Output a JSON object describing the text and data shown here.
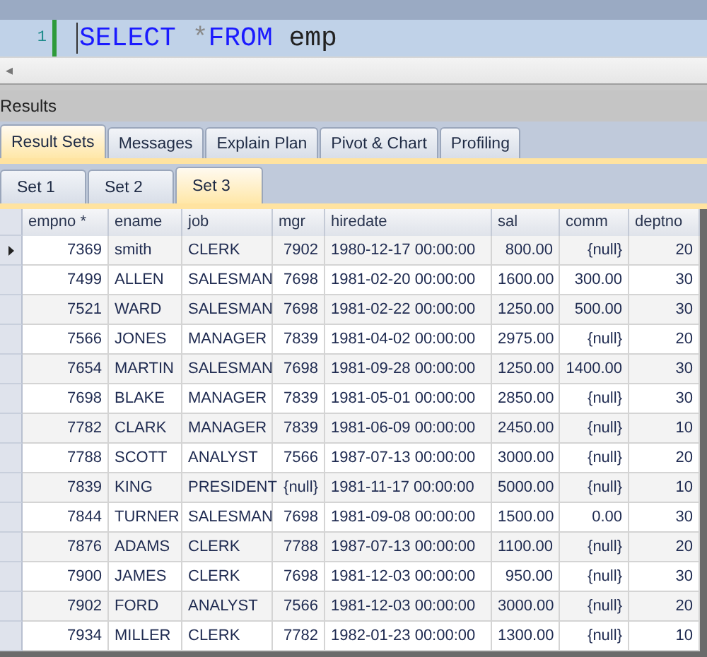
{
  "editor": {
    "line_number": "1",
    "tokens": [
      {
        "kind": "keyword",
        "text": "SELECT"
      },
      {
        "kind": "operator",
        "text": "*"
      },
      {
        "kind": "keyword",
        "text": "FROM"
      },
      {
        "kind": "identifier",
        "text": "emp"
      }
    ]
  },
  "scrollbar": {
    "left_arrow": "◂"
  },
  "results": {
    "title": "Results",
    "tabs": [
      {
        "label": "Result Sets",
        "selected": true
      },
      {
        "label": "Messages",
        "selected": false
      },
      {
        "label": "Explain Plan",
        "selected": false
      },
      {
        "label": "Pivot & Chart",
        "selected": false
      },
      {
        "label": "Profiling",
        "selected": false
      }
    ],
    "sets": [
      {
        "label": "Set 1",
        "selected": false
      },
      {
        "label": "Set 2",
        "selected": false
      },
      {
        "label": "Set 3",
        "selected": true
      }
    ],
    "table": {
      "columns": [
        {
          "label": "empno *",
          "kind": "number"
        },
        {
          "label": "ename",
          "kind": "text"
        },
        {
          "label": "job",
          "kind": "text"
        },
        {
          "label": "mgr",
          "kind": "number"
        },
        {
          "label": "hiredate",
          "kind": "text"
        },
        {
          "label": "sal",
          "kind": "number"
        },
        {
          "label": "comm",
          "kind": "number"
        },
        {
          "label": "deptno",
          "kind": "number"
        }
      ],
      "rows": [
        {
          "selected": true,
          "cells": [
            "7369",
            "smith",
            "CLERK",
            "7902",
            "1980-12-17 00:00:00",
            "800.00",
            "{null}",
            "20"
          ]
        },
        {
          "selected": false,
          "cells": [
            "7499",
            "ALLEN",
            "SALESMAN",
            "7698",
            "1981-02-20 00:00:00",
            "1600.00",
            "300.00",
            "30"
          ]
        },
        {
          "selected": false,
          "cells": [
            "7521",
            "WARD",
            "SALESMAN",
            "7698",
            "1981-02-22 00:00:00",
            "1250.00",
            "500.00",
            "30"
          ]
        },
        {
          "selected": false,
          "cells": [
            "7566",
            "JONES",
            "MANAGER",
            "7839",
            "1981-04-02 00:00:00",
            "2975.00",
            "{null}",
            "20"
          ]
        },
        {
          "selected": false,
          "cells": [
            "7654",
            "MARTIN",
            "SALESMAN",
            "7698",
            "1981-09-28 00:00:00",
            "1250.00",
            "1400.00",
            "30"
          ]
        },
        {
          "selected": false,
          "cells": [
            "7698",
            "BLAKE",
            "MANAGER",
            "7839",
            "1981-05-01 00:00:00",
            "2850.00",
            "{null}",
            "30"
          ]
        },
        {
          "selected": false,
          "cells": [
            "7782",
            "CLARK",
            "MANAGER",
            "7839",
            "1981-06-09 00:00:00",
            "2450.00",
            "{null}",
            "10"
          ]
        },
        {
          "selected": false,
          "cells": [
            "7788",
            "SCOTT",
            "ANALYST",
            "7566",
            "1987-07-13 00:00:00",
            "3000.00",
            "{null}",
            "20"
          ]
        },
        {
          "selected": false,
          "cells": [
            "7839",
            "KING",
            "PRESIDENT",
            "{null}",
            "1981-11-17 00:00:00",
            "5000.00",
            "{null}",
            "10"
          ]
        },
        {
          "selected": false,
          "cells": [
            "7844",
            "TURNER",
            "SALESMAN",
            "7698",
            "1981-09-08 00:00:00",
            "1500.00",
            "0.00",
            "30"
          ]
        },
        {
          "selected": false,
          "cells": [
            "7876",
            "ADAMS",
            "CLERK",
            "7788",
            "1987-07-13 00:00:00",
            "1100.00",
            "{null}",
            "20"
          ]
        },
        {
          "selected": false,
          "cells": [
            "7900",
            "JAMES",
            "CLERK",
            "7698",
            "1981-12-03 00:00:00",
            "950.00",
            "{null}",
            "30"
          ]
        },
        {
          "selected": false,
          "cells": [
            "7902",
            "FORD",
            "ANALYST",
            "7566",
            "1981-12-03 00:00:00",
            "3000.00",
            "{null}",
            "20"
          ]
        },
        {
          "selected": false,
          "cells": [
            "7934",
            "MILLER",
            "CLERK",
            "7782",
            "1982-01-23 00:00:00",
            "1300.00",
            "{null}",
            "10"
          ]
        }
      ]
    }
  }
}
